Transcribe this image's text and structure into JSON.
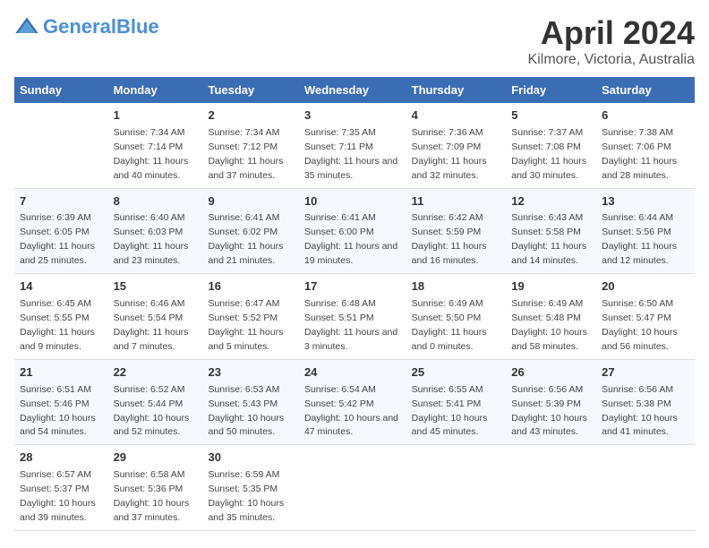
{
  "header": {
    "logo_general": "General",
    "logo_blue": "Blue",
    "title": "April 2024",
    "subtitle": "Kilmore, Victoria, Australia"
  },
  "columns": [
    "Sunday",
    "Monday",
    "Tuesday",
    "Wednesday",
    "Thursday",
    "Friday",
    "Saturday"
  ],
  "weeks": [
    [
      {
        "day": "",
        "sunrise": "",
        "sunset": "",
        "daylight": ""
      },
      {
        "day": "1",
        "sunrise": "Sunrise: 7:34 AM",
        "sunset": "Sunset: 7:14 PM",
        "daylight": "Daylight: 11 hours and 40 minutes."
      },
      {
        "day": "2",
        "sunrise": "Sunrise: 7:34 AM",
        "sunset": "Sunset: 7:12 PM",
        "daylight": "Daylight: 11 hours and 37 minutes."
      },
      {
        "day": "3",
        "sunrise": "Sunrise: 7:35 AM",
        "sunset": "Sunset: 7:11 PM",
        "daylight": "Daylight: 11 hours and 35 minutes."
      },
      {
        "day": "4",
        "sunrise": "Sunrise: 7:36 AM",
        "sunset": "Sunset: 7:09 PM",
        "daylight": "Daylight: 11 hours and 32 minutes."
      },
      {
        "day": "5",
        "sunrise": "Sunrise: 7:37 AM",
        "sunset": "Sunset: 7:08 PM",
        "daylight": "Daylight: 11 hours and 30 minutes."
      },
      {
        "day": "6",
        "sunrise": "Sunrise: 7:38 AM",
        "sunset": "Sunset: 7:06 PM",
        "daylight": "Daylight: 11 hours and 28 minutes."
      }
    ],
    [
      {
        "day": "7",
        "sunrise": "Sunrise: 6:39 AM",
        "sunset": "Sunset: 6:05 PM",
        "daylight": "Daylight: 11 hours and 25 minutes."
      },
      {
        "day": "8",
        "sunrise": "Sunrise: 6:40 AM",
        "sunset": "Sunset: 6:03 PM",
        "daylight": "Daylight: 11 hours and 23 minutes."
      },
      {
        "day": "9",
        "sunrise": "Sunrise: 6:41 AM",
        "sunset": "Sunset: 6:02 PM",
        "daylight": "Daylight: 11 hours and 21 minutes."
      },
      {
        "day": "10",
        "sunrise": "Sunrise: 6:41 AM",
        "sunset": "Sunset: 6:00 PM",
        "daylight": "Daylight: 11 hours and 19 minutes."
      },
      {
        "day": "11",
        "sunrise": "Sunrise: 6:42 AM",
        "sunset": "Sunset: 5:59 PM",
        "daylight": "Daylight: 11 hours and 16 minutes."
      },
      {
        "day": "12",
        "sunrise": "Sunrise: 6:43 AM",
        "sunset": "Sunset: 5:58 PM",
        "daylight": "Daylight: 11 hours and 14 minutes."
      },
      {
        "day": "13",
        "sunrise": "Sunrise: 6:44 AM",
        "sunset": "Sunset: 5:56 PM",
        "daylight": "Daylight: 11 hours and 12 minutes."
      }
    ],
    [
      {
        "day": "14",
        "sunrise": "Sunrise: 6:45 AM",
        "sunset": "Sunset: 5:55 PM",
        "daylight": "Daylight: 11 hours and 9 minutes."
      },
      {
        "day": "15",
        "sunrise": "Sunrise: 6:46 AM",
        "sunset": "Sunset: 5:54 PM",
        "daylight": "Daylight: 11 hours and 7 minutes."
      },
      {
        "day": "16",
        "sunrise": "Sunrise: 6:47 AM",
        "sunset": "Sunset: 5:52 PM",
        "daylight": "Daylight: 11 hours and 5 minutes."
      },
      {
        "day": "17",
        "sunrise": "Sunrise: 6:48 AM",
        "sunset": "Sunset: 5:51 PM",
        "daylight": "Daylight: 11 hours and 3 minutes."
      },
      {
        "day": "18",
        "sunrise": "Sunrise: 6:49 AM",
        "sunset": "Sunset: 5:50 PM",
        "daylight": "Daylight: 11 hours and 0 minutes."
      },
      {
        "day": "19",
        "sunrise": "Sunrise: 6:49 AM",
        "sunset": "Sunset: 5:48 PM",
        "daylight": "Daylight: 10 hours and 58 minutes."
      },
      {
        "day": "20",
        "sunrise": "Sunrise: 6:50 AM",
        "sunset": "Sunset: 5:47 PM",
        "daylight": "Daylight: 10 hours and 56 minutes."
      }
    ],
    [
      {
        "day": "21",
        "sunrise": "Sunrise: 6:51 AM",
        "sunset": "Sunset: 5:46 PM",
        "daylight": "Daylight: 10 hours and 54 minutes."
      },
      {
        "day": "22",
        "sunrise": "Sunrise: 6:52 AM",
        "sunset": "Sunset: 5:44 PM",
        "daylight": "Daylight: 10 hours and 52 minutes."
      },
      {
        "day": "23",
        "sunrise": "Sunrise: 6:53 AM",
        "sunset": "Sunset: 5:43 PM",
        "daylight": "Daylight: 10 hours and 50 minutes."
      },
      {
        "day": "24",
        "sunrise": "Sunrise: 6:54 AM",
        "sunset": "Sunset: 5:42 PM",
        "daylight": "Daylight: 10 hours and 47 minutes."
      },
      {
        "day": "25",
        "sunrise": "Sunrise: 6:55 AM",
        "sunset": "Sunset: 5:41 PM",
        "daylight": "Daylight: 10 hours and 45 minutes."
      },
      {
        "day": "26",
        "sunrise": "Sunrise: 6:56 AM",
        "sunset": "Sunset: 5:39 PM",
        "daylight": "Daylight: 10 hours and 43 minutes."
      },
      {
        "day": "27",
        "sunrise": "Sunrise: 6:56 AM",
        "sunset": "Sunset: 5:38 PM",
        "daylight": "Daylight: 10 hours and 41 minutes."
      }
    ],
    [
      {
        "day": "28",
        "sunrise": "Sunrise: 6:57 AM",
        "sunset": "Sunset: 5:37 PM",
        "daylight": "Daylight: 10 hours and 39 minutes."
      },
      {
        "day": "29",
        "sunrise": "Sunrise: 6:58 AM",
        "sunset": "Sunset: 5:36 PM",
        "daylight": "Daylight: 10 hours and 37 minutes."
      },
      {
        "day": "30",
        "sunrise": "Sunrise: 6:59 AM",
        "sunset": "Sunset: 5:35 PM",
        "daylight": "Daylight: 10 hours and 35 minutes."
      },
      {
        "day": "",
        "sunrise": "",
        "sunset": "",
        "daylight": ""
      },
      {
        "day": "",
        "sunrise": "",
        "sunset": "",
        "daylight": ""
      },
      {
        "day": "",
        "sunrise": "",
        "sunset": "",
        "daylight": ""
      },
      {
        "day": "",
        "sunrise": "",
        "sunset": "",
        "daylight": ""
      }
    ]
  ]
}
